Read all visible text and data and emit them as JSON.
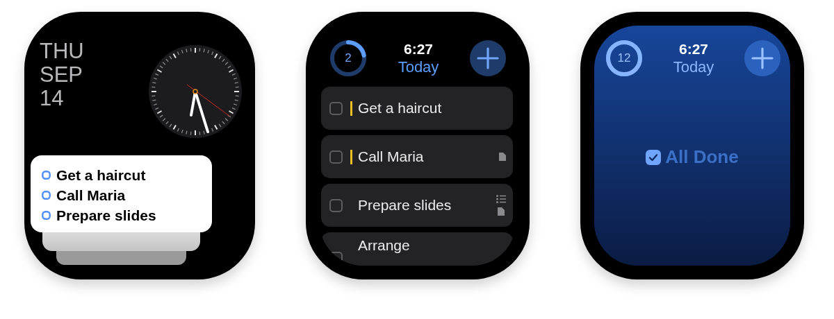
{
  "watches": [
    {
      "kind": "complication",
      "date": [
        "THU",
        "SEP",
        "14"
      ],
      "reminders": [
        {
          "title": "Get a haircut"
        },
        {
          "title": "Call Maria"
        },
        {
          "title": "Prepare slides"
        }
      ]
    },
    {
      "kind": "list",
      "progress": {
        "count": "2"
      },
      "time": "6:27",
      "list_title": "Today",
      "tasks": [
        {
          "title": "Get a haircut",
          "checked": false,
          "flagged": true
        },
        {
          "title": "Call Maria",
          "checked": false,
          "flagged": true,
          "attachments": [
            {
              "kind": "note"
            }
          ]
        },
        {
          "title": "Prepare slides",
          "checked": false,
          "flagged": false,
          "attachments": [
            {
              "kind": "subtasks"
            },
            {
              "kind": "note"
            }
          ]
        },
        {
          "title": "Arrange",
          "checked": false,
          "flagged": false
        }
      ]
    },
    {
      "kind": "done",
      "progress": {
        "count": "12"
      },
      "time": "6:27",
      "list_title": "Today",
      "message": "All Done"
    }
  ]
}
